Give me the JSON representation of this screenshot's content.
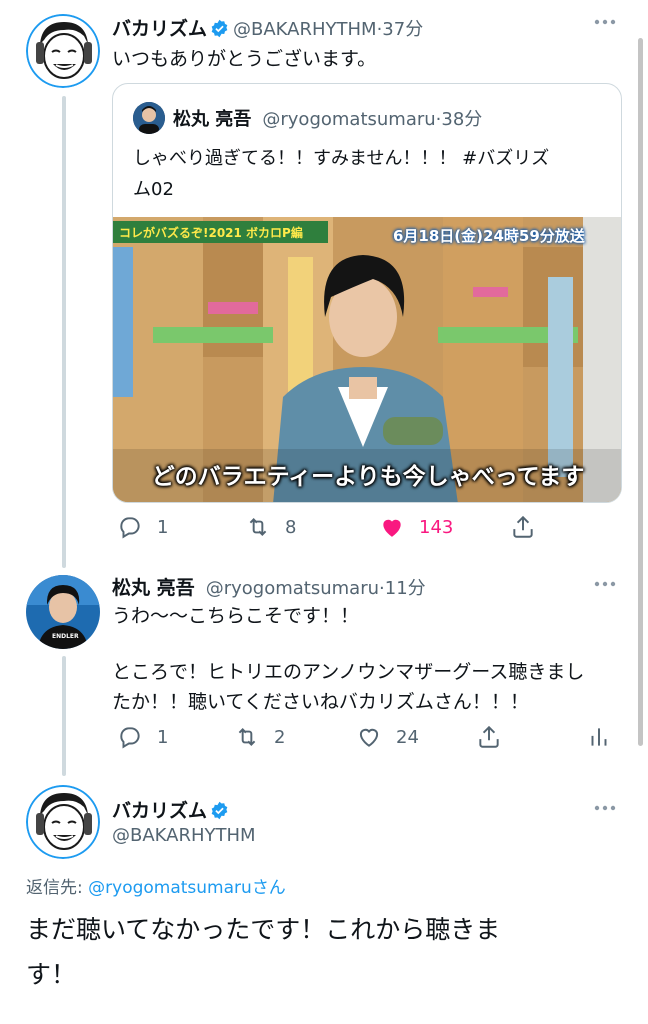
{
  "tweets": [
    {
      "name": "バカリズム",
      "handle": "@BAKARHYTHM",
      "time": "·37分",
      "text": "いつもありがとうございます。",
      "quote": {
        "name": "松丸 亮吾",
        "handle": "@ryogomatsumaru",
        "time": "·38分",
        "text_line1": "しゃべり過ぎてる！！すみません！！！ #バズリズ",
        "text_line2": "ム02",
        "media": {
          "badge_left": "コレがバズるぞ!2021 ボカロP編",
          "badge_right": "6月18日(金)24時59分放送",
          "caption": "どのバラエティーよりも今しゃべってます"
        }
      },
      "actions": {
        "replies": "1",
        "retweets": "8",
        "likes": "143"
      }
    },
    {
      "name": "松丸 亮吾",
      "handle": "@ryogomatsumaru",
      "time": "·11分",
      "text_line1": "うわ〜〜こちらこそです！！",
      "text_line2": "ところで！ヒトリエのアンノウンマザーグース聴きまし",
      "text_line3": "たか！！聴いてくださいねバカリズムさん！！！",
      "shirt_text": "ENDLER",
      "actions": {
        "replies": "1",
        "retweets": "2",
        "likes": "24"
      }
    },
    {
      "name": "バカリズム",
      "handle": "@BAKARHYTHM",
      "reply_label": "返信先: ",
      "reply_to": "@ryogomatsumaru",
      "reply_suffix": "さん",
      "text_line1": "まだ聴いてなかったです！これから聴きま",
      "text_line2": "す！"
    }
  ],
  "more_icon": "more-dots-icon",
  "colors": {
    "accent": "#1d9bf0",
    "like": "#f91880",
    "muted": "#536471",
    "border": "#cfd9de"
  }
}
